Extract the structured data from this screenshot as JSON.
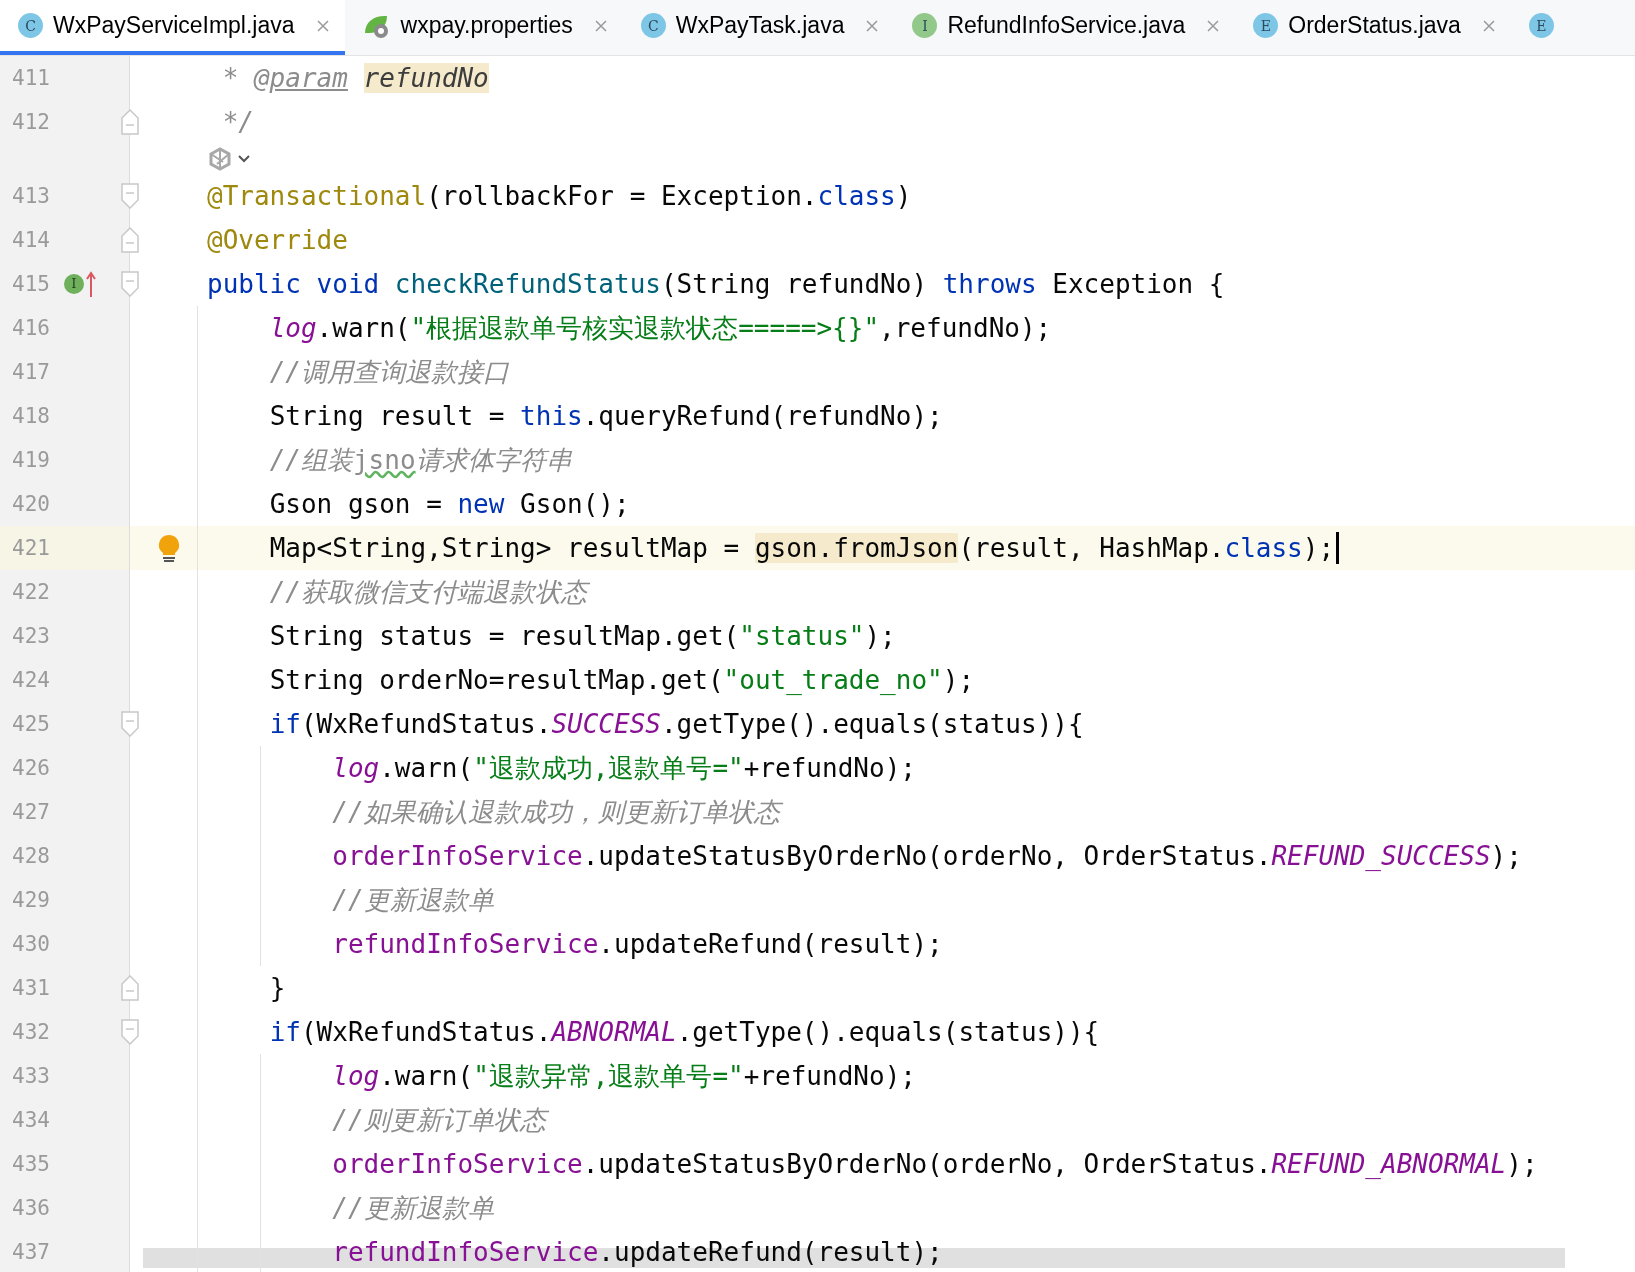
{
  "tabs": [
    {
      "kind": "class",
      "icon_letter": "C",
      "label": "WxPayServiceImpl.java",
      "selected": true
    },
    {
      "kind": "properties",
      "label": "wxpay.properties",
      "selected": false
    },
    {
      "kind": "class",
      "icon_letter": "C",
      "label": "WxPayTask.java",
      "selected": false
    },
    {
      "kind": "interface",
      "icon_letter": "I",
      "label": "RefundInfoService.java",
      "selected": false
    },
    {
      "kind": "enum",
      "icon_letter": "E",
      "label": "OrderStatus.java",
      "selected": false
    },
    {
      "kind": "enum",
      "icon_letter": "E",
      "selected": false
    }
  ],
  "lines": [
    {
      "kind": "code",
      "number": "411",
      "current": false,
      "tokens": [
        {
          "kind": "comment",
          "text": " * "
        },
        {
          "kind": "doc_tag",
          "text": "@param"
        },
        {
          "kind": "doc_param",
          "text": " refundNo"
        }
      ]
    },
    {
      "kind": "code",
      "number": "412",
      "current": false,
      "fold": {
        "kind": "end"
      },
      "tokens": [
        {
          "kind": "comment",
          "text": " */"
        }
      ]
    },
    {
      "kind": "inlay"
    },
    {
      "kind": "code",
      "number": "413",
      "current": false,
      "fold": {
        "kind": "start"
      },
      "tokens": [
        {
          "kind": "annotation",
          "text": "@Transactional"
        },
        {
          "kind": "plain",
          "text": "(rollbackFor = Exception."
        },
        {
          "kind": "keyword",
          "text": "class"
        },
        {
          "kind": "plain",
          "text": ")"
        }
      ]
    },
    {
      "kind": "code",
      "number": "414",
      "current": false,
      "fold": {
        "kind": "end"
      },
      "tokens": [
        {
          "kind": "annotation",
          "text": "@Override"
        }
      ]
    },
    {
      "kind": "code",
      "number": "415",
      "current": false,
      "fold": {
        "kind": "start"
      },
      "gutter": {
        "kind": "implements",
        "letter": "I"
      },
      "tokens": [
        {
          "kind": "keyword",
          "text": "public void "
        },
        {
          "kind": "method",
          "text": "checkRefundStatus"
        },
        {
          "kind": "plain",
          "text": "(String refundNo) "
        },
        {
          "kind": "keyword",
          "text": "throws"
        },
        {
          "kind": "plain",
          "text": " Exception {"
        }
      ]
    },
    {
      "kind": "code",
      "number": "416",
      "current": false,
      "tokens": [
        {
          "kind": "static",
          "text": "    log"
        },
        {
          "kind": "plain",
          "text": ".warn("
        },
        {
          "kind": "string",
          "text": "\"根据退款单号核实退款状态=====>{}\""
        },
        {
          "kind": "plain",
          "text": ",refundNo);"
        }
      ]
    },
    {
      "kind": "code",
      "number": "417",
      "current": false,
      "tokens": [
        {
          "kind": "comment",
          "text": "    //调用查询退款接口"
        }
      ]
    },
    {
      "kind": "code",
      "number": "418",
      "current": false,
      "tokens": [
        {
          "kind": "plain",
          "text": "    String result = "
        },
        {
          "kind": "keyword",
          "text": "this"
        },
        {
          "kind": "plain",
          "text": ".queryRefund(refundNo);"
        }
      ]
    },
    {
      "kind": "code",
      "number": "419",
      "current": false,
      "tokens": [
        {
          "kind": "comment",
          "text": "    //组装"
        },
        {
          "kind": "typo",
          "text": "jsno"
        },
        {
          "kind": "comment",
          "text": "请求体字符串"
        }
      ]
    },
    {
      "kind": "code",
      "number": "420",
      "current": false,
      "tokens": [
        {
          "kind": "plain",
          "text": "    Gson gson = "
        },
        {
          "kind": "keyword",
          "text": "new"
        },
        {
          "kind": "plain",
          "text": " Gson();"
        }
      ]
    },
    {
      "kind": "code",
      "number": "421",
      "current": true,
      "gutter": {
        "kind": "bulb"
      },
      "tokens": [
        {
          "kind": "plain",
          "text": "    Map<String,String> resultMap = "
        },
        {
          "kind": "match",
          "text": "gson.fromJson"
        },
        {
          "kind": "plain",
          "text": "(result, HashMap."
        },
        {
          "kind": "keyword",
          "text": "class"
        },
        {
          "kind": "plain",
          "text": ");"
        }
      ]
    },
    {
      "kind": "code",
      "number": "422",
      "current": false,
      "tokens": [
        {
          "kind": "comment",
          "text": "    //获取微信支付端退款状态"
        }
      ]
    },
    {
      "kind": "code",
      "number": "423",
      "current": false,
      "tokens": [
        {
          "kind": "plain",
          "text": "    String status = resultMap.get("
        },
        {
          "kind": "string",
          "text": "\"status\""
        },
        {
          "kind": "plain",
          "text": ");"
        }
      ]
    },
    {
      "kind": "code",
      "number": "424",
      "current": false,
      "tokens": [
        {
          "kind": "plain",
          "text": "    String orderNo=resultMap.get("
        },
        {
          "kind": "string",
          "text": "\"out_trade_no\""
        },
        {
          "kind": "plain",
          "text": ");"
        }
      ]
    },
    {
      "kind": "code",
      "number": "425",
      "current": false,
      "fold": {
        "kind": "start"
      },
      "tokens": [
        {
          "kind": "keyword",
          "text": "    if"
        },
        {
          "kind": "plain",
          "text": "(WxRefundStatus."
        },
        {
          "kind": "static",
          "text": "SUCCESS"
        },
        {
          "kind": "plain",
          "text": ".getType().equals(status)){"
        }
      ]
    },
    {
      "kind": "code",
      "number": "426",
      "current": false,
      "tokens": [
        {
          "kind": "static",
          "text": "        log"
        },
        {
          "kind": "plain",
          "text": ".warn("
        },
        {
          "kind": "string",
          "text": "\"退款成功,退款单号=\""
        },
        {
          "kind": "plain",
          "text": "+refundNo);"
        }
      ]
    },
    {
      "kind": "code",
      "number": "427",
      "current": false,
      "tokens": [
        {
          "kind": "comment",
          "text": "        //如果确认退款成功，则更新订单状态"
        }
      ]
    },
    {
      "kind": "code",
      "number": "428",
      "current": false,
      "tokens": [
        {
          "kind": "field",
          "text": "        orderInfoService"
        },
        {
          "kind": "plain",
          "text": ".updateStatusByOrderNo(orderNo, OrderStatus."
        },
        {
          "kind": "static",
          "text": "REFUND_SUCCESS"
        },
        {
          "kind": "plain",
          "text": ");"
        }
      ]
    },
    {
      "kind": "code",
      "number": "429",
      "current": false,
      "tokens": [
        {
          "kind": "comment",
          "text": "        //更新退款单"
        }
      ]
    },
    {
      "kind": "code",
      "number": "430",
      "current": false,
      "tokens": [
        {
          "kind": "field",
          "text": "        refundInfoService"
        },
        {
          "kind": "plain",
          "text": ".updateRefund(result);"
        }
      ]
    },
    {
      "kind": "code",
      "number": "431",
      "current": false,
      "fold": {
        "kind": "end"
      },
      "tokens": [
        {
          "kind": "plain",
          "text": "    }"
        }
      ]
    },
    {
      "kind": "code",
      "number": "432",
      "current": false,
      "fold": {
        "kind": "start"
      },
      "tokens": [
        {
          "kind": "keyword",
          "text": "    if"
        },
        {
          "kind": "plain",
          "text": "(WxRefundStatus."
        },
        {
          "kind": "static",
          "text": "ABNORMAL"
        },
        {
          "kind": "plain",
          "text": ".getType().equals(status)){"
        }
      ]
    },
    {
      "kind": "code",
      "number": "433",
      "current": false,
      "tokens": [
        {
          "kind": "static",
          "text": "        log"
        },
        {
          "kind": "plain",
          "text": ".warn("
        },
        {
          "kind": "string",
          "text": "\"退款异常,退款单号=\""
        },
        {
          "kind": "plain",
          "text": "+refundNo);"
        }
      ]
    },
    {
      "kind": "code",
      "number": "434",
      "current": false,
      "tokens": [
        {
          "kind": "comment",
          "text": "        //则更新订单状态"
        }
      ]
    },
    {
      "kind": "code",
      "number": "435",
      "current": false,
      "tokens": [
        {
          "kind": "field",
          "text": "        orderInfoService"
        },
        {
          "kind": "plain",
          "text": ".updateStatusByOrderNo(orderNo, OrderStatus."
        },
        {
          "kind": "static",
          "text": "REFUND_ABNORMAL"
        },
        {
          "kind": "plain",
          "text": ");"
        }
      ]
    },
    {
      "kind": "code",
      "number": "436",
      "current": false,
      "tokens": [
        {
          "kind": "comment",
          "text": "        //更新退款单"
        }
      ]
    },
    {
      "kind": "code",
      "number": "437",
      "current": false,
      "tokens": [
        {
          "kind": "field",
          "text": "        refundInfoService"
        },
        {
          "kind": "plain",
          "text": ".updateRefund(result);"
        }
      ]
    }
  ]
}
